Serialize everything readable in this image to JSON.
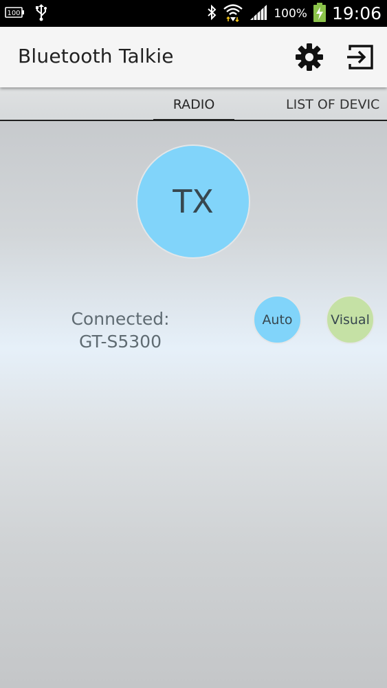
{
  "status_bar": {
    "left_icons": [
      "battery-100-notification-icon",
      "usb-icon"
    ],
    "right_icons": [
      "bluetooth-icon",
      "wifi-icon",
      "signal-icon",
      "battery-charging-icon"
    ],
    "battery_notification_text": "100",
    "battery_percent": "100%",
    "time": "19:06"
  },
  "app_bar": {
    "title": "Bluetooth Talkie",
    "settings_icon": "gear-icon",
    "exit_icon": "exit-icon"
  },
  "tabs": [
    {
      "label": "RADIO",
      "selected": true
    },
    {
      "label": "LIST OF DEVIC",
      "selected": false
    }
  ],
  "main": {
    "tx_label": "TX",
    "connection_status_line1": "Connected:",
    "connection_status_line2": "GT-S5300",
    "auto_label": "Auto",
    "visual_label": "Visual"
  },
  "colors": {
    "status_bar_bg": "#000000",
    "app_bar_bg": "#f5f5f5",
    "tx_button": "#81d4fa",
    "auto_button": "#81d4fa",
    "visual_button": "#c5e1a5",
    "battery_green": "#8bc34a"
  }
}
